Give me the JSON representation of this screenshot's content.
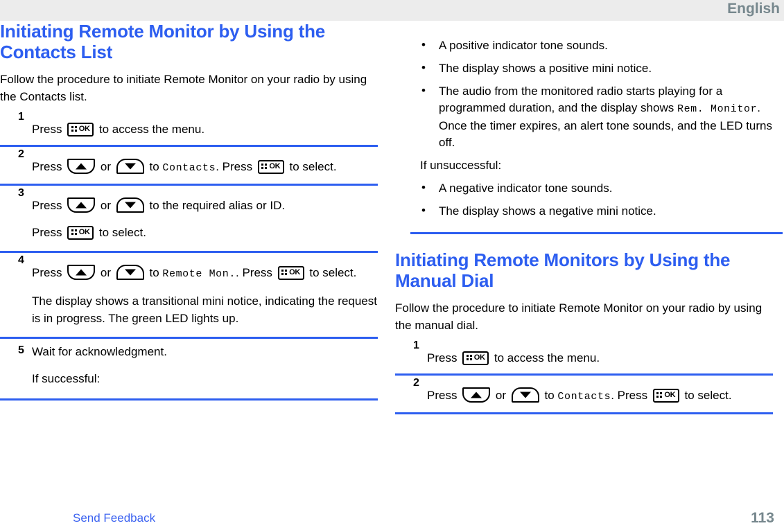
{
  "header": {
    "language": "English"
  },
  "left_column": {
    "title": "Initiating Remote Monitor by Using the Contacts List",
    "intro": "Follow the procedure to initiate Remote Monitor on your radio by using the Contacts list.",
    "steps": [
      {
        "number": "1",
        "parts": [
          {
            "text": "Press "
          },
          {
            "key": "ok"
          },
          {
            "text": " to access the menu."
          }
        ]
      },
      {
        "number": "2",
        "parts": [
          {
            "text": "Press "
          },
          {
            "key": "up"
          },
          {
            "text": " or "
          },
          {
            "key": "down"
          },
          {
            "text": " to "
          },
          {
            "mono": "Contacts"
          },
          {
            "text": ". Press "
          },
          {
            "key": "ok"
          },
          {
            "text": " to select."
          }
        ]
      },
      {
        "number": "3",
        "line1": [
          {
            "text": "Press "
          },
          {
            "key": "up"
          },
          {
            "text": " or "
          },
          {
            "key": "down"
          },
          {
            "text": " to the required alias or ID."
          }
        ],
        "line2": [
          {
            "text": "Press "
          },
          {
            "key": "ok"
          },
          {
            "text": " to select."
          }
        ]
      },
      {
        "number": "4",
        "line1": [
          {
            "text": "Press "
          },
          {
            "key": "up"
          },
          {
            "text": " or "
          },
          {
            "key": "down"
          },
          {
            "text": " to "
          },
          {
            "mono": "Remote Mon."
          },
          {
            "text": ". Press "
          },
          {
            "key": "ok"
          },
          {
            "text": " to select."
          }
        ],
        "note": "The display shows a transitional mini notice, indicating the request is in progress. The green LED lights up."
      },
      {
        "number": "5",
        "text": "Wait for acknowledgment.",
        "note": "If successful:"
      }
    ]
  },
  "right_column": {
    "success_bullets": [
      "A positive indicator tone sounds.",
      "The display shows a positive mini notice."
    ],
    "audio_bullet": {
      "before": "The audio from the monitored radio starts playing for a programmed duration, and the display shows ",
      "mono": "Rem. Monitor",
      "after": ". Once the timer expires, an alert tone sounds, and the LED turns off."
    },
    "unsuccessful_label": "If unsuccessful:",
    "unsuccessful_bullets": [
      "A negative indicator tone sounds.",
      "The display shows a negative mini notice."
    ],
    "title": "Initiating Remote Monitors by Using the Manual Dial",
    "intro": "Follow the procedure to initiate Remote Monitor on your radio by using the manual dial.",
    "steps": [
      {
        "number": "1",
        "parts": [
          {
            "text": "Press "
          },
          {
            "key": "ok"
          },
          {
            "text": " to access the menu."
          }
        ]
      },
      {
        "number": "2",
        "parts": [
          {
            "text": "Press "
          },
          {
            "key": "up"
          },
          {
            "text": " or "
          },
          {
            "key": "down"
          },
          {
            "text": " to "
          },
          {
            "mono": "Contacts"
          },
          {
            "text": ". Press "
          },
          {
            "key": "ok"
          },
          {
            "text": " to select."
          }
        ]
      }
    ]
  },
  "footer": {
    "feedback_label": "Send Feedback",
    "page_number": "113"
  },
  "icons": {
    "ok_key_label": "OK",
    "bullet": "•"
  },
  "colors": {
    "heading_blue": "#2d5ef0",
    "link_blue": "#3b62f0",
    "page_number_gray": "#76878d",
    "header_band": "#ececec",
    "divider_blue": "#2d5ef0"
  }
}
